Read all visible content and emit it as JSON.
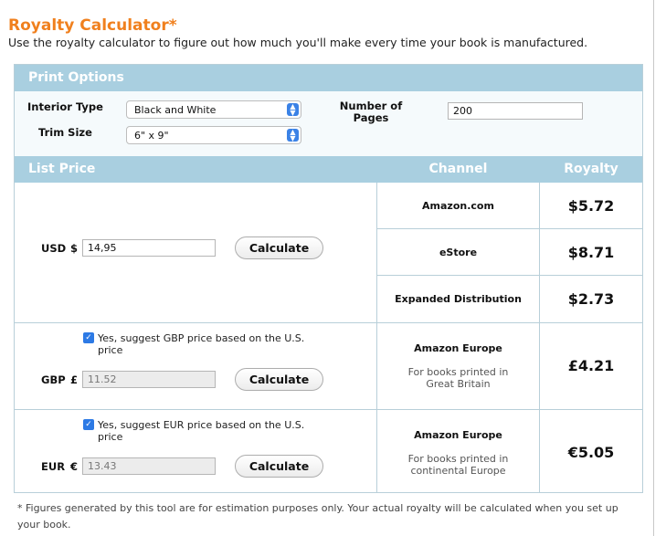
{
  "header": {
    "title": "Royalty Calculator*",
    "subtitle": "Use the royalty calculator to figure out how much you'll make every time your book is manufactured."
  },
  "print_options": {
    "heading": "Print Options",
    "interior_type_label": "Interior Type",
    "interior_type_value": "Black and White",
    "trim_size_label": "Trim Size",
    "trim_size_value": "6\" x 9\"",
    "pages_label_line1": "Number of",
    "pages_label_line2": "Pages",
    "pages_value": "200"
  },
  "table_header": {
    "list_price": "List Price",
    "channel": "Channel",
    "royalty": "Royalty"
  },
  "usd": {
    "label": "USD",
    "symbol": "$",
    "value": "14,95",
    "button": "Calculate",
    "channels": [
      {
        "name": "Amazon.com",
        "royalty": "$5.72"
      },
      {
        "name": "eStore",
        "royalty": "$8.71"
      },
      {
        "name": "Expanded Distribution",
        "royalty": "$2.73"
      }
    ]
  },
  "gbp": {
    "checkbox_line1": "Yes, suggest GBP price based on the U.S.",
    "checkbox_line2": "price",
    "label": "GBP",
    "symbol": "£",
    "value": "11.52",
    "button": "Calculate",
    "channel_name": "Amazon Europe",
    "channel_note_line1": "For books printed in",
    "channel_note_line2": "Great Britain",
    "royalty": "£4.21"
  },
  "eur": {
    "checkbox_line1": "Yes, suggest EUR price based on the U.S.",
    "checkbox_line2": "price",
    "label": "EUR",
    "symbol": "€",
    "value": "13.43",
    "button": "Calculate",
    "channel_name": "Amazon Europe",
    "channel_note_line1": "For books printed in",
    "channel_note_line2": "continental Europe",
    "royalty": "€5.05"
  },
  "footnote": {
    "line1": "* Figures generated by this tool are for estimation purposes only. Your actual royalty will be calculated when you set up",
    "line2": "your book."
  },
  "colors": {
    "title": "#f0801e",
    "band": "#a9cfe0",
    "checkbox": "#2d7ae5"
  }
}
